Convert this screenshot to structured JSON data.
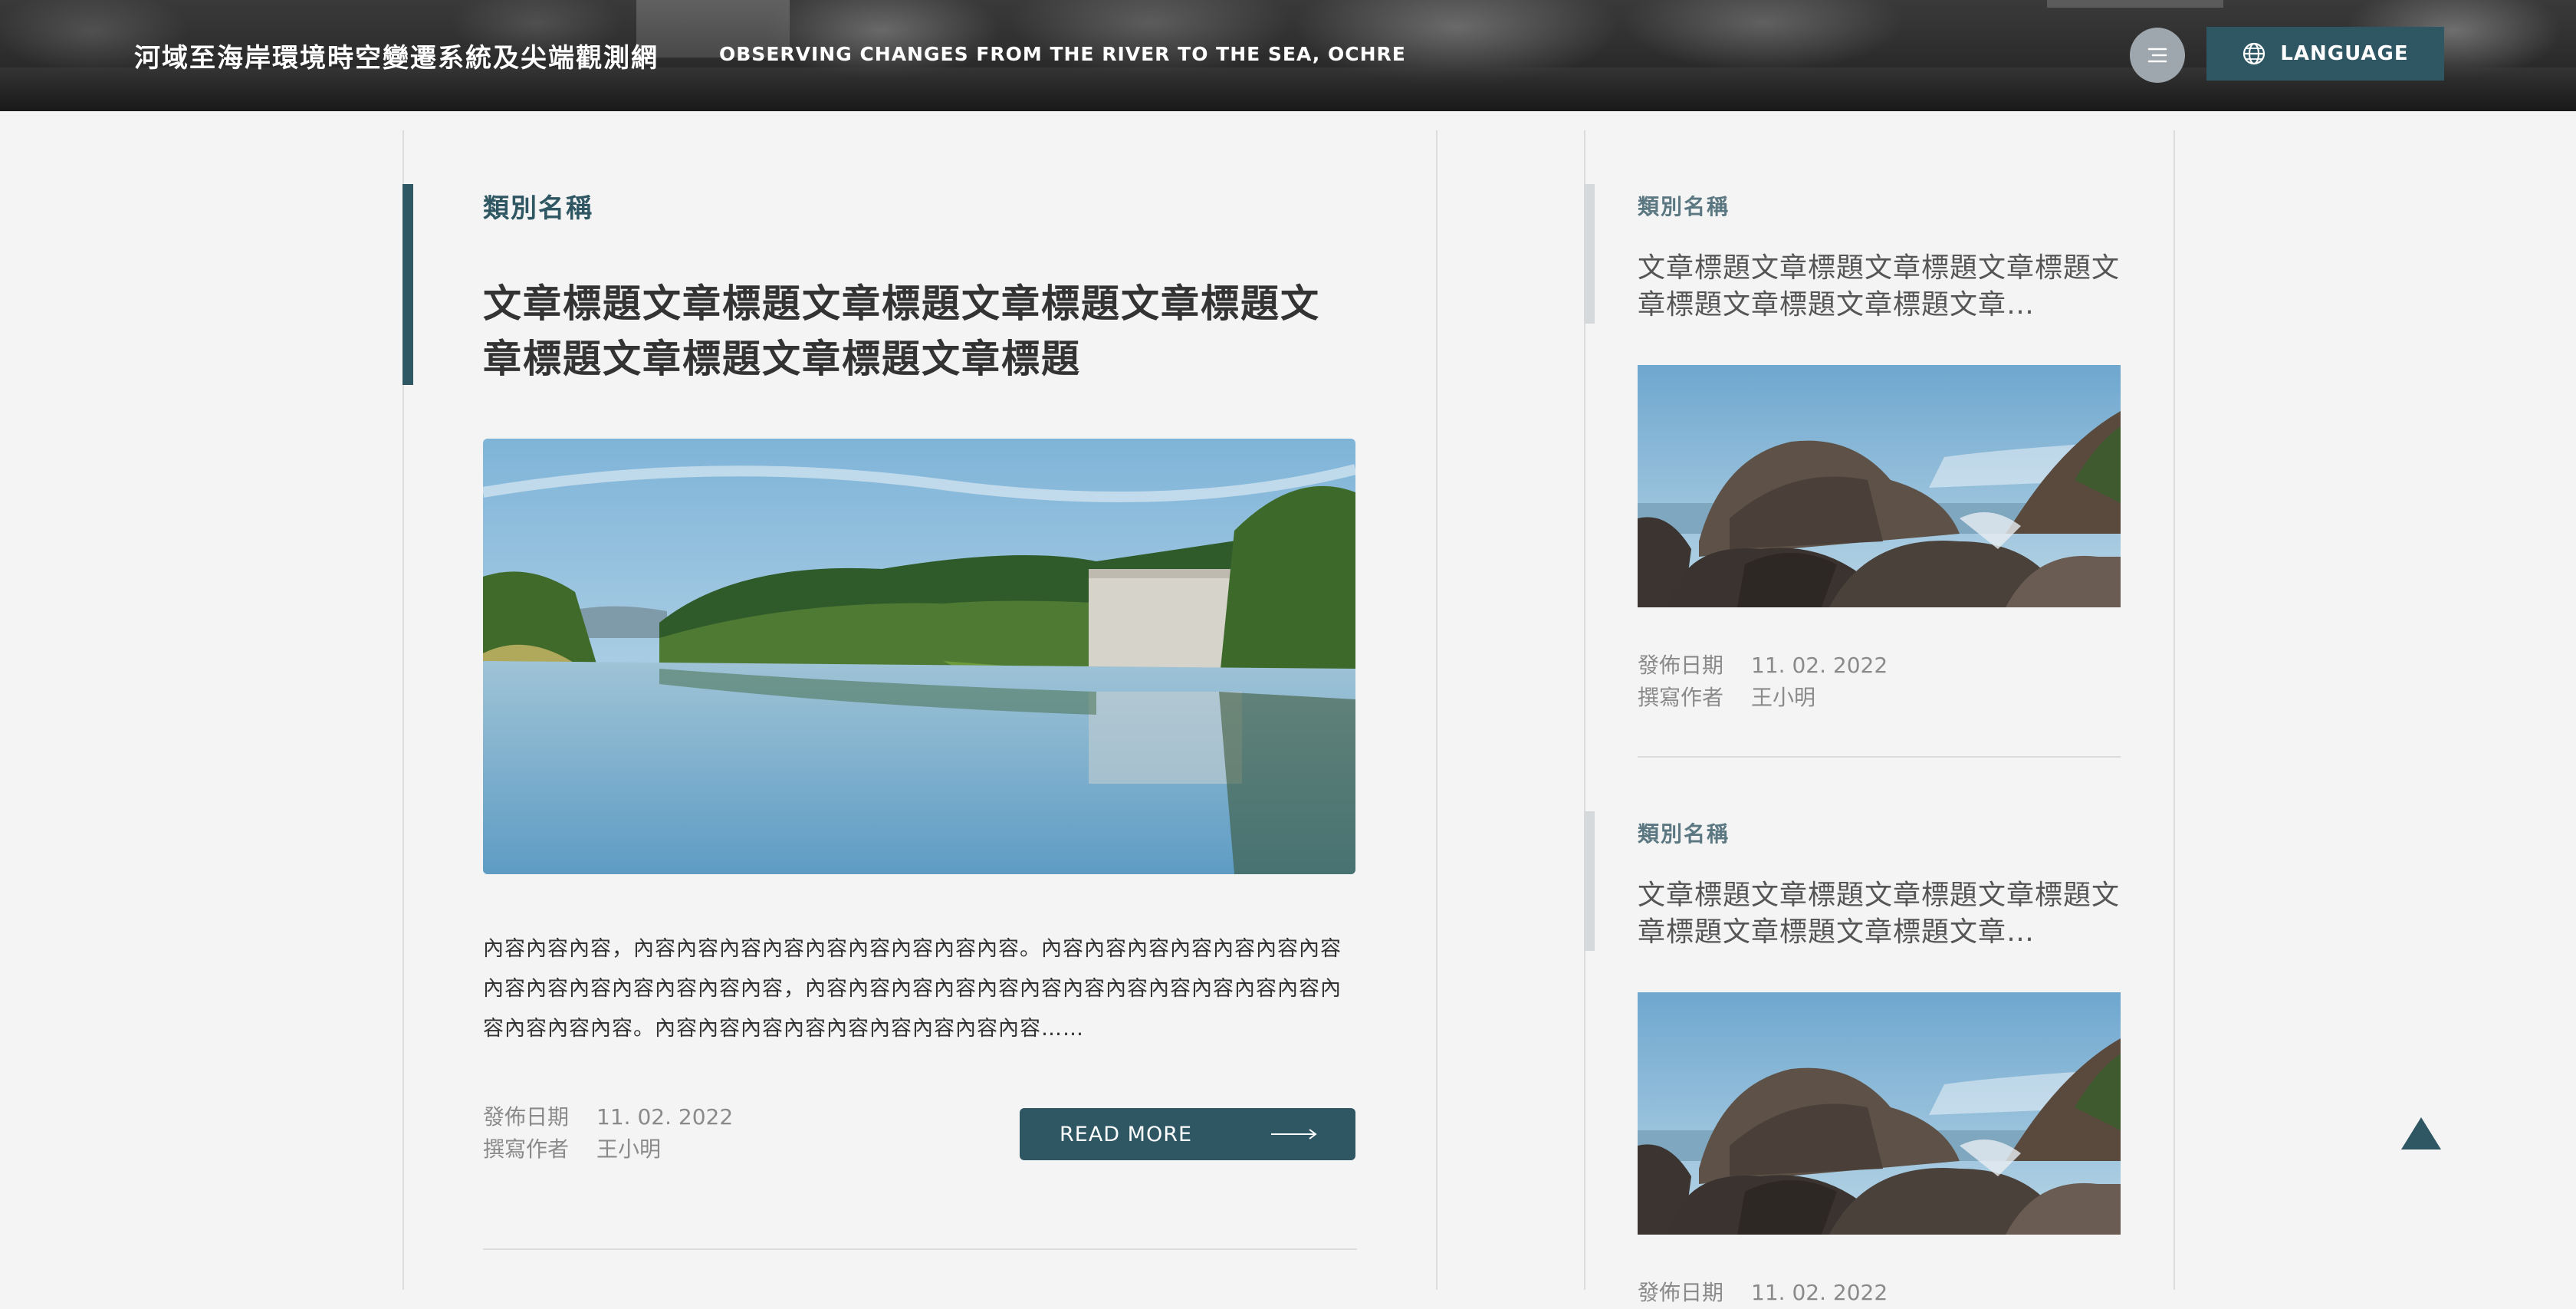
{
  "header": {
    "site_title": "河域至海岸環境時空變遷系統及尖端觀測網",
    "site_subtitle": "OBSERVING CHANGES FROM THE RIVER TO THE SEA, OCHRE",
    "menu_icon": "menu-lines-icon",
    "language_label": "LANGUAGE",
    "language_icon": "globe-icon"
  },
  "main_article": {
    "category": "類別名稱",
    "title": "文章標題文章標題文章標題文章標題文章標題文章標題文章標題文章標題文章標題",
    "excerpt": "內容內容內容，內容內容內容內容內容內容內容內容內容。內容內容內容內容內容內容內容內容內容內容內容內容內容內容，內容內容內容內容內容內容內容內容內容內容內容內容內容內容內容內容。內容內容內容內容內容內容內容內容內容……",
    "date_label": "發佈日期",
    "date_value": "11. 02. 2022",
    "author_label": "撰寫作者",
    "author_value": "王小明",
    "read_more_label": "READ MORE"
  },
  "side_articles": [
    {
      "category": "類別名稱",
      "title": "文章標題文章標題文章標題文章標題文章標題文章標題文章標題文章…",
      "date_label": "發佈日期",
      "date_value": "11. 02. 2022",
      "author_label": "撰寫作者",
      "author_value": "王小明"
    },
    {
      "category": "類別名稱",
      "title": "文章標題文章標題文章標題文章標題文章標題文章標題文章標題文章…",
      "date_label": "發佈日期",
      "date_value": "11. 02. 2022"
    }
  ],
  "colors": {
    "accent": "#2f5663",
    "background": "#f4f4f4",
    "menu_button": "#9ea7ad",
    "side_accent": "#d6d9db"
  },
  "back_to_top_icon": "triangle-up-icon"
}
